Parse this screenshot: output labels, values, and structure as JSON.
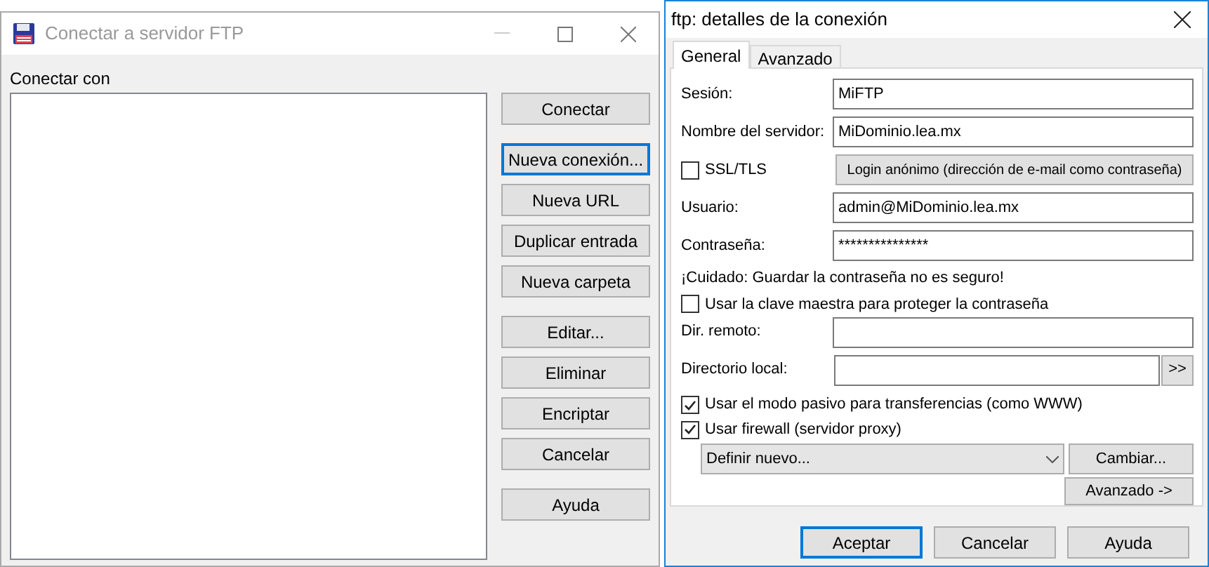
{
  "left_window": {
    "title": "Conectar a servidor FTP",
    "list_label": "Conectar con",
    "button_groups": [
      [
        {
          "label": "Conectar",
          "focused": false
        }
      ],
      [
        {
          "label": "Nueva conexión...",
          "focused": true
        },
        {
          "label": "Nueva URL",
          "focused": false
        },
        {
          "label": "Duplicar entrada",
          "focused": false
        },
        {
          "label": "Nueva carpeta",
          "focused": false
        }
      ],
      [
        {
          "label": "Editar...",
          "focused": false
        },
        {
          "label": "Eliminar",
          "focused": false
        },
        {
          "label": "Encriptar",
          "focused": false
        },
        {
          "label": "Cancelar",
          "focused": false
        }
      ],
      [
        {
          "label": "Ayuda",
          "focused": false
        }
      ]
    ]
  },
  "dialog": {
    "title": "ftp: detalles de la conexión",
    "tabs": [
      {
        "label": "General",
        "selected": true
      },
      {
        "label": "Avanzado",
        "selected": false
      }
    ],
    "rows": [
      {
        "kind": "field",
        "label": "Sesión:",
        "value": "MiFTP"
      },
      {
        "kind": "field",
        "label": "Nombre del servidor:",
        "value": "MiDominio.lea.mx"
      },
      {
        "kind": "check_button",
        "label": "SSL/TLS",
        "checked": false,
        "button": "Login anónimo (dirección de e-mail como contraseña)"
      },
      {
        "kind": "field",
        "label": "Usuario:",
        "value": "admin@MiDominio.lea.mx"
      },
      {
        "kind": "field",
        "label": "Contraseña:",
        "value": "***************"
      },
      {
        "kind": "note",
        "text": "¡Cuidado: Guardar la contraseña no es seguro!"
      },
      {
        "kind": "checkbox",
        "label": "Usar la clave maestra para proteger la contraseña",
        "checked": false
      },
      {
        "kind": "field",
        "label": "Dir. remoto:"
      },
      {
        "kind": "browse",
        "label": "Directorio local:",
        "button": ">>"
      },
      {
        "kind": "checkbox",
        "label": "Usar el modo pasivo para transferencias (como WWW)",
        "checked": true
      },
      {
        "kind": "checkbox",
        "label": "Usar firewall (servidor proxy)",
        "checked": true
      },
      {
        "kind": "select",
        "value": "Definir nuevo...",
        "button": "Cambiar..."
      },
      {
        "kind": "button_right",
        "label": "Avanzado ->"
      }
    ],
    "footer": [
      {
        "label": "Aceptar",
        "focused": true
      },
      {
        "label": "Cancelar",
        "focused": false
      },
      {
        "label": "Ayuda",
        "focused": false
      }
    ]
  }
}
